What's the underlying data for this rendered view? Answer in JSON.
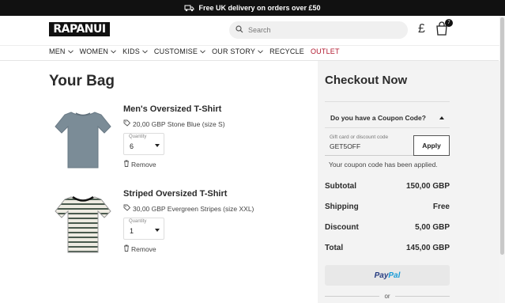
{
  "promo": {
    "text": "Free UK delivery on orders over £50",
    "icon": "truck-icon"
  },
  "header": {
    "logo": "RAPANUI",
    "search": {
      "placeholder": "Search",
      "value": ""
    },
    "currency": "£",
    "bag_count": "7"
  },
  "nav": {
    "items": [
      {
        "label": "MEN",
        "has_dropdown": true
      },
      {
        "label": "WOMEN",
        "has_dropdown": true
      },
      {
        "label": "KIDS",
        "has_dropdown": true
      },
      {
        "label": "CUSTOMISE",
        "has_dropdown": true
      },
      {
        "label": "OUR STORY",
        "has_dropdown": true
      },
      {
        "label": "RECYCLE",
        "has_dropdown": false
      },
      {
        "label": "OUTLET",
        "has_dropdown": false,
        "color": "#b0182e"
      }
    ]
  },
  "bag": {
    "title": "Your Bag",
    "products": [
      {
        "name": "Men's Oversized T-Shirt",
        "details": "20,00 GBP Stone Blue (size S)",
        "quantity_label": "Quantity",
        "quantity": "6",
        "remove_label": "Remove",
        "color": "#7b8c97"
      },
      {
        "name": "Striped Oversized T-Shirt",
        "details": "30,00 GBP Evergreen Stripes (size XXL)",
        "quantity_label": "Quantity",
        "quantity": "1",
        "remove_label": "Remove",
        "color": "#e9e6dc"
      }
    ]
  },
  "checkout": {
    "title": "Checkout Now",
    "coupon": {
      "toggle_label": "Do you have a Coupon Code?",
      "field_label": "Gift card or discount code",
      "value": "GET5OFF",
      "apply_label": "Apply",
      "message": "Your coupon code has been applied."
    },
    "summary": [
      {
        "label": "Subtotal",
        "value": "150,00 GBP"
      },
      {
        "label": "Shipping",
        "value": "Free"
      },
      {
        "label": "Discount",
        "value": "5,00 GBP"
      },
      {
        "label": "Total",
        "value": "145,00 GBP"
      }
    ],
    "paypal": {
      "pay": "Pay",
      "pal": "Pal"
    },
    "or_label": "or"
  },
  "colors": {
    "accent": "#111111",
    "outlet": "#b0182e",
    "panel": "#f3f3f3"
  }
}
